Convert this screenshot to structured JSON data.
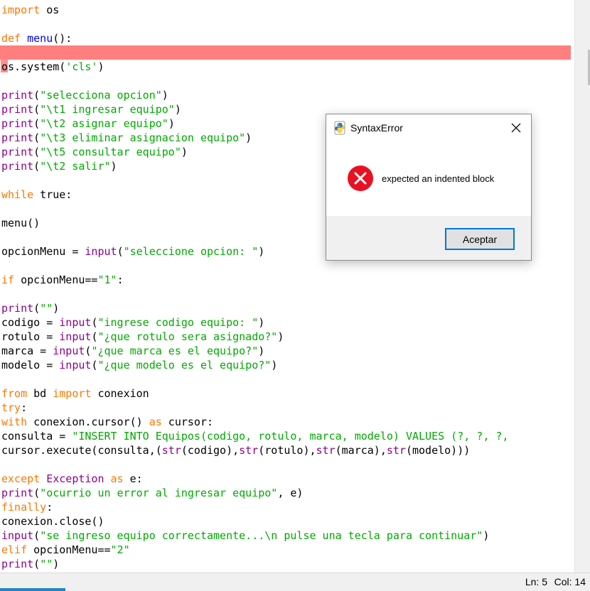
{
  "editor": {
    "lines": [
      [
        {
          "t": "import",
          "c": "kw"
        },
        {
          "t": " os",
          "c": ""
        }
      ],
      [],
      [
        {
          "t": "def",
          "c": "kw"
        },
        {
          "t": " ",
          "c": ""
        },
        {
          "t": "menu",
          "c": "def"
        },
        {
          "t": "():",
          "c": ""
        }
      ],
      [],
      [
        {
          "t": "os.system(",
          "c": ""
        },
        {
          "t": "'cls'",
          "c": "str"
        },
        {
          "t": ")",
          "c": ""
        }
      ],
      [],
      [
        {
          "t": "print",
          "c": "bi"
        },
        {
          "t": "(",
          "c": ""
        },
        {
          "t": "\"selecciona opcion\"",
          "c": "str"
        },
        {
          "t": ")",
          "c": ""
        }
      ],
      [
        {
          "t": "print",
          "c": "bi"
        },
        {
          "t": "(",
          "c": ""
        },
        {
          "t": "\"\\t1 ingresar equipo\"",
          "c": "str"
        },
        {
          "t": ")",
          "c": ""
        }
      ],
      [
        {
          "t": "print",
          "c": "bi"
        },
        {
          "t": "(",
          "c": ""
        },
        {
          "t": "\"\\t2 asignar equipo\"",
          "c": "str"
        },
        {
          "t": ")",
          "c": ""
        }
      ],
      [
        {
          "t": "print",
          "c": "bi"
        },
        {
          "t": "(",
          "c": ""
        },
        {
          "t": "\"\\t3 eliminar asignacion equipo\"",
          "c": "str"
        },
        {
          "t": ")",
          "c": ""
        }
      ],
      [
        {
          "t": "print",
          "c": "bi"
        },
        {
          "t": "(",
          "c": ""
        },
        {
          "t": "\"\\t5 consultar equipo\"",
          "c": "str"
        },
        {
          "t": ")",
          "c": ""
        }
      ],
      [
        {
          "t": "print",
          "c": "bi"
        },
        {
          "t": "(",
          "c": ""
        },
        {
          "t": "\"\\t2 salir\"",
          "c": "str"
        },
        {
          "t": ")",
          "c": ""
        }
      ],
      [],
      [
        {
          "t": "while",
          "c": "kw"
        },
        {
          "t": " true:",
          "c": ""
        }
      ],
      [],
      [
        {
          "t": "menu()",
          "c": ""
        }
      ],
      [],
      [
        {
          "t": "opcionMenu = ",
          "c": ""
        },
        {
          "t": "input",
          "c": "bi"
        },
        {
          "t": "(",
          "c": ""
        },
        {
          "t": "\"seleccione opcion: \"",
          "c": "str"
        },
        {
          "t": ")",
          "c": ""
        }
      ],
      [],
      [
        {
          "t": "if",
          "c": "kw"
        },
        {
          "t": " opcionMenu==",
          "c": ""
        },
        {
          "t": "\"1\"",
          "c": "str"
        },
        {
          "t": ":",
          "c": ""
        }
      ],
      [],
      [
        {
          "t": "print",
          "c": "bi"
        },
        {
          "t": "(",
          "c": ""
        },
        {
          "t": "\"\"",
          "c": "str"
        },
        {
          "t": ")",
          "c": ""
        }
      ],
      [
        {
          "t": "codigo = ",
          "c": ""
        },
        {
          "t": "input",
          "c": "bi"
        },
        {
          "t": "(",
          "c": ""
        },
        {
          "t": "\"ingrese codigo equipo: \"",
          "c": "str"
        },
        {
          "t": ")",
          "c": ""
        }
      ],
      [
        {
          "t": "rotulo = ",
          "c": ""
        },
        {
          "t": "input",
          "c": "bi"
        },
        {
          "t": "(",
          "c": ""
        },
        {
          "t": "\"¿que rotulo sera asignado?\"",
          "c": "str"
        },
        {
          "t": ")",
          "c": ""
        }
      ],
      [
        {
          "t": "marca = ",
          "c": ""
        },
        {
          "t": "input",
          "c": "bi"
        },
        {
          "t": "(",
          "c": ""
        },
        {
          "t": "\"¿que marca es el equipo?\"",
          "c": "str"
        },
        {
          "t": ")",
          "c": ""
        }
      ],
      [
        {
          "t": "modelo = ",
          "c": ""
        },
        {
          "t": "input",
          "c": "bi"
        },
        {
          "t": "(",
          "c": ""
        },
        {
          "t": "\"¿que modelo es el equipo?\"",
          "c": "str"
        },
        {
          "t": ")",
          "c": ""
        }
      ],
      [],
      [
        {
          "t": "from",
          "c": "kw"
        },
        {
          "t": " bd ",
          "c": ""
        },
        {
          "t": "import",
          "c": "kw"
        },
        {
          "t": " conexion",
          "c": ""
        }
      ],
      [
        {
          "t": "try",
          "c": "kw"
        },
        {
          "t": ":",
          "c": ""
        }
      ],
      [
        {
          "t": "with",
          "c": "kw"
        },
        {
          "t": " conexion.cursor() ",
          "c": ""
        },
        {
          "t": "as",
          "c": "kw"
        },
        {
          "t": " cursor:",
          "c": ""
        }
      ],
      [
        {
          "t": "consulta = ",
          "c": ""
        },
        {
          "t": "\"INSERT INTO Equipos(codigo, rotulo, marca, modelo) VALUES (?, ?, ?,",
          "c": "str"
        }
      ],
      [
        {
          "t": "cursor.execute(consulta,(",
          "c": ""
        },
        {
          "t": "str",
          "c": "bi"
        },
        {
          "t": "(codigo),",
          "c": ""
        },
        {
          "t": "str",
          "c": "bi"
        },
        {
          "t": "(rotulo),",
          "c": ""
        },
        {
          "t": "str",
          "c": "bi"
        },
        {
          "t": "(marca),",
          "c": ""
        },
        {
          "t": "str",
          "c": "bi"
        },
        {
          "t": "(modelo)))",
          "c": ""
        }
      ],
      [],
      [
        {
          "t": "except",
          "c": "kw"
        },
        {
          "t": " ",
          "c": ""
        },
        {
          "t": "Exception",
          "c": "bi"
        },
        {
          "t": " ",
          "c": ""
        },
        {
          "t": "as",
          "c": "kw"
        },
        {
          "t": " e:",
          "c": ""
        }
      ],
      [
        {
          "t": "print",
          "c": "bi"
        },
        {
          "t": "(",
          "c": ""
        },
        {
          "t": "\"ocurrio un error al ingresar equipo\"",
          "c": "str"
        },
        {
          "t": ", e)",
          "c": ""
        }
      ],
      [
        {
          "t": "finally",
          "c": "kw"
        },
        {
          "t": ":",
          "c": ""
        }
      ],
      [
        {
          "t": "conexion.close()",
          "c": ""
        }
      ],
      [
        {
          "t": "input",
          "c": "bi"
        },
        {
          "t": "(",
          "c": ""
        },
        {
          "t": "\"se ingreso equipo correctamente...\\n pulse una tecla para continuar\"",
          "c": "str"
        },
        {
          "t": ")",
          "c": ""
        }
      ],
      [
        {
          "t": "elif",
          "c": "kw"
        },
        {
          "t": " opcionMenu==",
          "c": ""
        },
        {
          "t": "\"2\"",
          "c": "str"
        }
      ],
      [
        {
          "t": "print",
          "c": "bi"
        },
        {
          "t": "(",
          "c": ""
        },
        {
          "t": "\"\"",
          "c": "str"
        },
        {
          "t": ")",
          "c": ""
        }
      ]
    ]
  },
  "statusbar": {
    "ln": "Ln: 5",
    "col": "Col: 14"
  },
  "dialog": {
    "title": "SyntaxError",
    "title_icon": "python-icon",
    "message": "expected an indented block",
    "error_icon": "error-icon",
    "ok_label": "Aceptar"
  },
  "colors": {
    "keyword": "#ff7700",
    "builtin": "#900090",
    "string": "#00aa00",
    "definition": "#0000ff",
    "error_highlight": "#ff7f7f",
    "button_focus": "#0078d7"
  }
}
